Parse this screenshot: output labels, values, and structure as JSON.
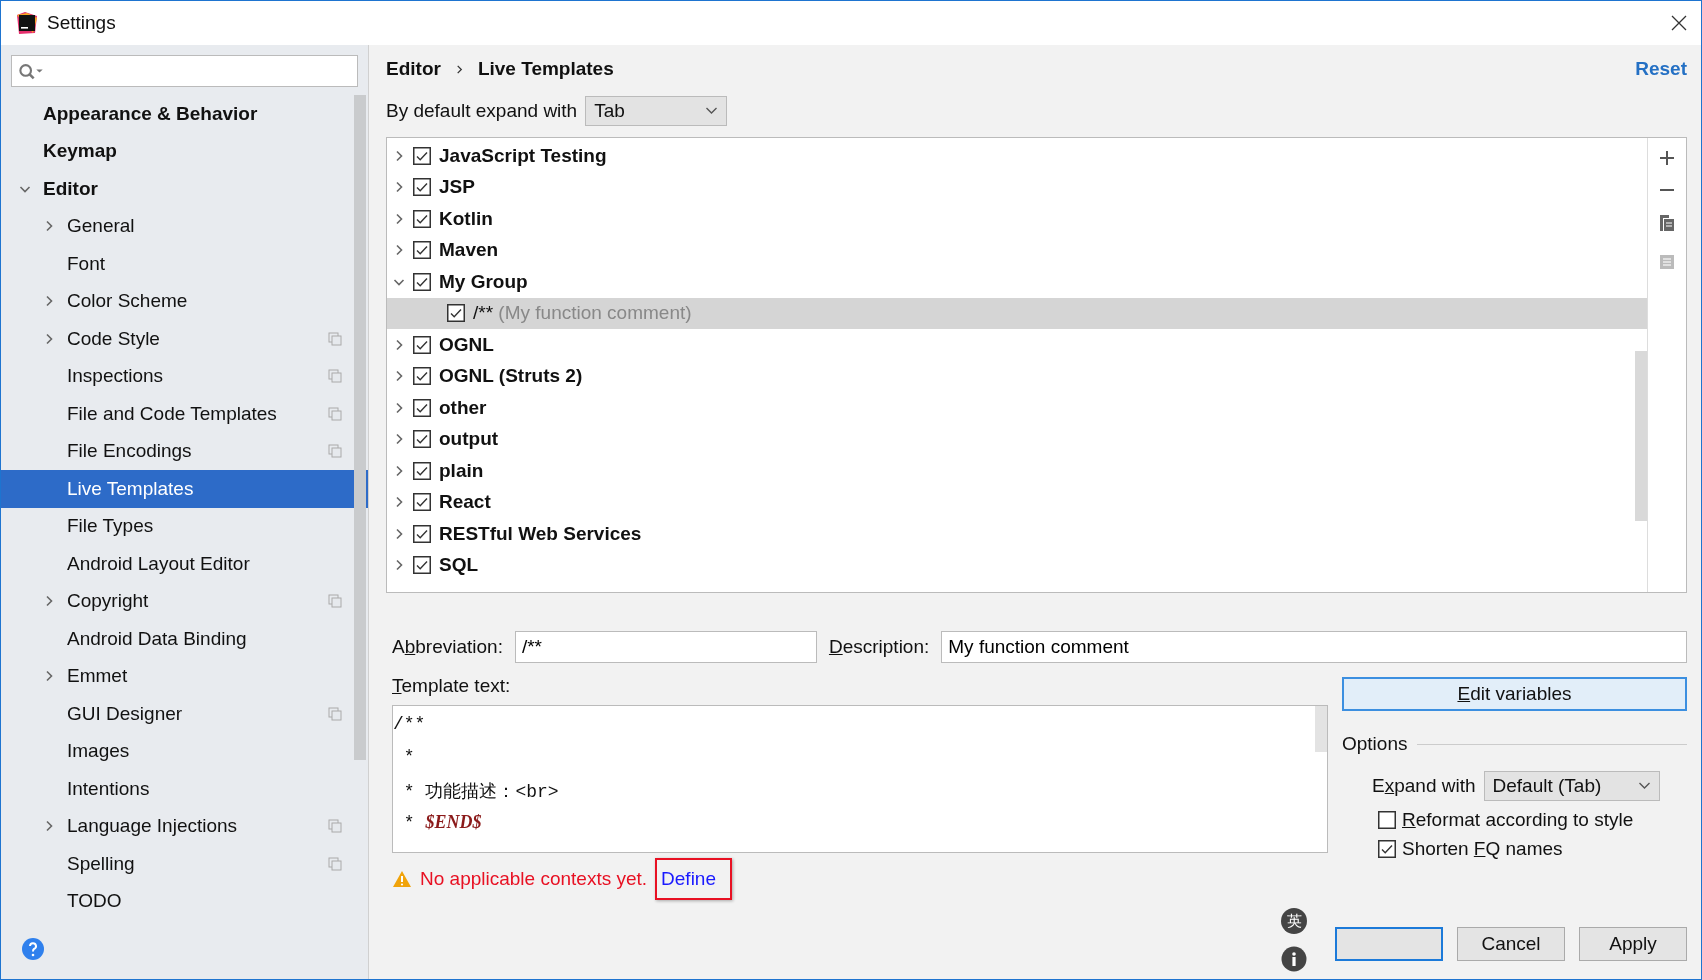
{
  "window": {
    "title": "Settings"
  },
  "sidebar": {
    "items": [
      {
        "label": "Appearance & Behavior",
        "expandable": false,
        "selected": false,
        "shared": false
      },
      {
        "label": "Keymap",
        "expandable": false,
        "selected": false,
        "shared": false
      },
      {
        "label": "Editor",
        "expandable": true,
        "expanded": true,
        "selected": false,
        "shared": false,
        "children": [
          {
            "label": "General",
            "expandable": true,
            "expanded": false,
            "selected": false,
            "shared": false
          },
          {
            "label": "Font",
            "expandable": false,
            "selected": false,
            "shared": false
          },
          {
            "label": "Color Scheme",
            "expandable": true,
            "expanded": false,
            "selected": false,
            "shared": false
          },
          {
            "label": "Code Style",
            "expandable": true,
            "expanded": false,
            "selected": false,
            "shared": true
          },
          {
            "label": "Inspections",
            "expandable": false,
            "selected": false,
            "shared": true
          },
          {
            "label": "File and Code Templates",
            "expandable": false,
            "selected": false,
            "shared": true
          },
          {
            "label": "File Encodings",
            "expandable": false,
            "selected": false,
            "shared": true
          },
          {
            "label": "Live Templates",
            "expandable": false,
            "selected": true,
            "shared": false
          },
          {
            "label": "File Types",
            "expandable": false,
            "selected": false,
            "shared": false
          },
          {
            "label": "Android Layout Editor",
            "expandable": false,
            "selected": false,
            "shared": false
          },
          {
            "label": "Copyright",
            "expandable": true,
            "expanded": false,
            "selected": false,
            "shared": true
          },
          {
            "label": "Android Data Binding",
            "expandable": false,
            "selected": false,
            "shared": false
          },
          {
            "label": "Emmet",
            "expandable": true,
            "expanded": false,
            "selected": false,
            "shared": false
          },
          {
            "label": "GUI Designer",
            "expandable": false,
            "selected": false,
            "shared": true
          },
          {
            "label": "Images",
            "expandable": false,
            "selected": false,
            "shared": false
          },
          {
            "label": "Intentions",
            "expandable": false,
            "selected": false,
            "shared": false
          },
          {
            "label": "Language Injections",
            "expandable": true,
            "expanded": false,
            "selected": false,
            "shared": true
          },
          {
            "label": "Spelling",
            "expandable": false,
            "selected": false,
            "shared": true
          },
          {
            "label": "TODO",
            "expandable": false,
            "selected": false,
            "shared": false
          }
        ]
      }
    ]
  },
  "breadcrumb": [
    "Editor",
    "Live Templates"
  ],
  "reset": "Reset",
  "expand_default": {
    "label": "By default expand with",
    "value": "Tab"
  },
  "templates": [
    {
      "name": "JavaScript Testing",
      "checked": true,
      "expanded": false
    },
    {
      "name": "JSP",
      "checked": true,
      "expanded": false
    },
    {
      "name": "Kotlin",
      "checked": true,
      "expanded": false
    },
    {
      "name": "Maven",
      "checked": true,
      "expanded": false
    },
    {
      "name": "My Group",
      "checked": true,
      "expanded": true,
      "children": [
        {
          "abbreviation": "/**",
          "description": "(My function comment)",
          "checked": true,
          "selected": true
        }
      ]
    },
    {
      "name": "OGNL",
      "checked": true,
      "expanded": false
    },
    {
      "name": "OGNL (Struts 2)",
      "checked": true,
      "expanded": false
    },
    {
      "name": "other",
      "checked": true,
      "expanded": false
    },
    {
      "name": "output",
      "checked": true,
      "expanded": false
    },
    {
      "name": "plain",
      "checked": true,
      "expanded": false
    },
    {
      "name": "React",
      "checked": true,
      "expanded": false
    },
    {
      "name": "RESTful Web Services",
      "checked": true,
      "expanded": false
    },
    {
      "name": "SQL",
      "checked": true,
      "expanded": false
    }
  ],
  "abbreviation": {
    "label_parts": {
      "before": "A",
      "key": "b",
      "after": "breviation:"
    },
    "value": "/**"
  },
  "description": {
    "label_parts": {
      "key": "D",
      "after": "escription:"
    },
    "value": "My function comment"
  },
  "template_text": {
    "label_parts": {
      "key": "T",
      "after": "emplate text:"
    },
    "lines": [
      {
        "kind": "plain",
        "text": "/**"
      },
      {
        "kind": "plain",
        "text": " *"
      },
      {
        "kind": "plain",
        "text": " * 功能描述：<br>"
      },
      {
        "kind": "variable",
        "prefix": " * ",
        "text": "$END$"
      }
    ]
  },
  "warning": {
    "text": "No applicable contexts yet.",
    "link": "Define"
  },
  "edit_variables": {
    "label_parts": {
      "key": "E",
      "after": "dit variables"
    }
  },
  "options": {
    "title": "Options",
    "expand_with": {
      "label_parts": {
        "before": "E",
        "key": "x",
        "after": "pand with"
      },
      "value": "Default (Tab)"
    },
    "checkboxes": [
      {
        "label_parts": {
          "key": "R",
          "after": "eformat according to style"
        },
        "checked": false
      },
      {
        "label_parts": {
          "before": "Shorten ",
          "key": "F",
          "after": "Q names"
        },
        "checked": true
      }
    ]
  },
  "ime": {
    "mode": "英"
  },
  "buttons": [
    {
      "label": "Cancel"
    },
    {
      "label": "Apply"
    }
  ]
}
